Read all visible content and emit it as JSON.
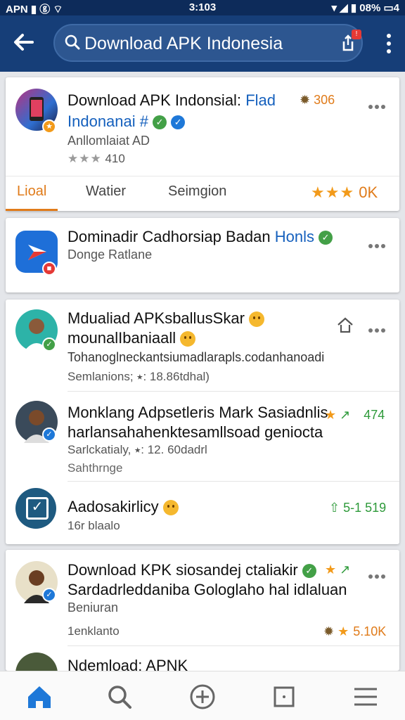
{
  "status_bar": {
    "left": "APN ▮ ⓖ ⌔",
    "time": "3:103",
    "right": "▾ ◢ ▮ 08% ▭4"
  },
  "app_bar": {
    "search_query": "Download APK Indonesia",
    "share_badge": "!"
  },
  "card1": {
    "title": "Download APK Indonsial:",
    "title_accent": "Flad",
    "subtitle": "Indonanai #",
    "dev": "Anllomlaiat AD",
    "stars": "★★★",
    "rating_count": "410",
    "stat_right": "306",
    "tabs": [
      {
        "label": "Lioal"
      },
      {
        "label": "Watier"
      },
      {
        "label": "Seimgion"
      }
    ],
    "tabs_right_label": "0K",
    "tabs_right_stars": "★★★"
  },
  "card2": {
    "title": "Dominadir Cadhorsiap Badan",
    "title_accent": "Honls",
    "subtitle": "Donge Ratlane"
  },
  "card3": {
    "items": [
      {
        "title_line1": "Mdualiad APKsballusSkar",
        "title_line2": "mounalIbaniaall",
        "desc": "Tohanoglneckantsiumadlarapls.codanhanoadi",
        "meta": "Semlanions; ⭑: 18.86tdhal)"
      },
      {
        "title_line1": "Monklang Adpsetleris Mark Sasiadnlis",
        "title_line2": "harlansahahenktesamllsoad geniocta",
        "meta": "Sarlckatialy, ⭑: 12. 60dadrl",
        "meta2": "Sahthrnge",
        "stat": "474"
      },
      {
        "title": "Aadosakirlicy",
        "meta": "16r blaalo",
        "stat": "5-1 519"
      }
    ]
  },
  "card4": {
    "title": "Download KPK siosandej ctaliakir",
    "line2": "Sardadrleddaniba Gologlaho hal idlaluan",
    "line3": "Beniuran",
    "meta": "1enklanto",
    "stat": "5.10K"
  },
  "card5": {
    "title": "Ndemload: APNK"
  },
  "colors": {
    "app_bar": "#163e78",
    "accent_orange": "#e07b1a",
    "verified_green": "#43a047",
    "verified_blue": "#1e78d8",
    "link_blue": "#1560bd"
  },
  "bottom_nav": [
    {
      "icon": "home-icon"
    },
    {
      "icon": "search-icon"
    },
    {
      "icon": "add-circle-icon"
    },
    {
      "icon": "square-icon"
    },
    {
      "icon": "menu-icon"
    }
  ]
}
